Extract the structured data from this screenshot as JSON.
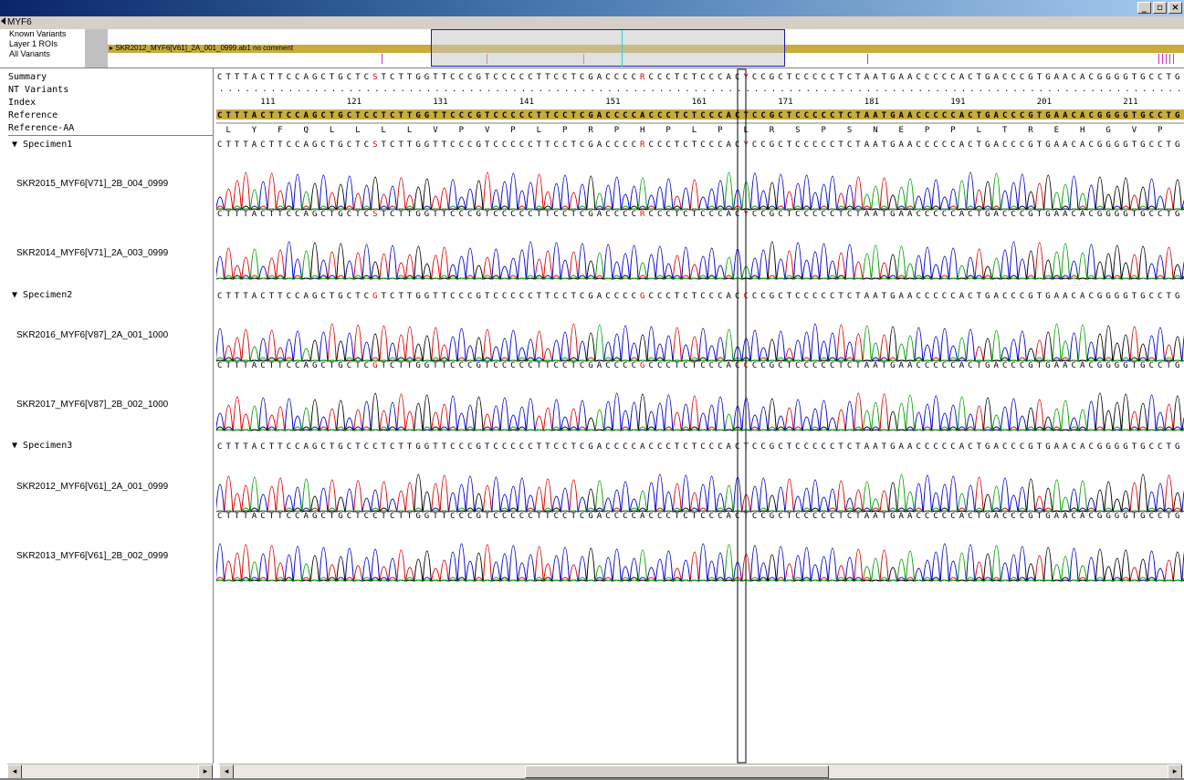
{
  "window": {
    "controls": {
      "minimize": "_",
      "restore": "▫",
      "close": "×"
    }
  },
  "gene_bar": {
    "title": "MYF6"
  },
  "overview": {
    "labels": [
      "Known Variants",
      "Layer 1 ROIs",
      "All Variants"
    ],
    "track_label": "SKR2012_MYF6[V61]_2A_001_0999.ab1 no comment"
  },
  "left_panel": {
    "rows": {
      "summary": "Summary",
      "nt_variants": "NT Variants",
      "index": "Index",
      "reference": "Reference",
      "reference_aa": "Reference-AA"
    },
    "specimens": [
      {
        "name": "Specimen1",
        "reads": [
          "SKR2015_MYF6[V71]_2B_004_0999",
          "SKR2014_MYF6[V71]_2A_003_0999"
        ]
      },
      {
        "name": "Specimen2",
        "reads": [
          "SKR2016_MYF6[V87]_2A_001_1000",
          "SKR2017_MYF6[V87]_2B_002_1000"
        ]
      },
      {
        "name": "Specimen3",
        "reads": [
          "SKR2012_MYF6[V61]_2A_001_0999",
          "SKR2013_MYF6[V61]_2B_002_0999"
        ]
      }
    ]
  },
  "sequence": {
    "summary": "CTTTACTTCCAGCTGCTCSTCTTGGTTCCCGTCCCCCTTCCTCGACCCCRCCCTCTCCCACYCCGCTCCCCCTCTAATGAACCCCCACTGACCCGTGAACACGGGGTGCCTGC",
    "reference": "CTTTACTTCCAGCTGCTCCTCTTGGTTCCCGTCCCCCTTCCTCGACCCCACCCTCTCCCACTCCGCTCCCCCTCTAATGAACCCCCACTGACCCGTGAACACGGGGTGCCTGC",
    "index_labels": [
      "111",
      "121",
      "131",
      "141",
      "151",
      "161",
      "171",
      "181",
      "191",
      "201",
      "211"
    ],
    "amino_acids": [
      "L",
      "Y",
      "F",
      "Q",
      "L",
      "L",
      "L",
      "L",
      "V",
      "P",
      "V",
      "P",
      "L",
      "P",
      "R",
      "P",
      "H",
      "P",
      "L",
      "P",
      "L",
      "R",
      "S",
      "P",
      "S",
      "N",
      "E",
      "P",
      "P",
      "L",
      "T",
      "R",
      "E",
      "H",
      "G",
      "V",
      "P"
    ],
    "reads": [
      {
        "seq": "CTTTACTTCCAGCTGCTCSTCTTGGTTCCCGTCCCCCTTCCTCGACCCCRCCCTCTCCCACYCCGCTCCCCCTCTAATGAACCCCCACTGACCCGTGAACACGGGGTGCCTGC"
      },
      {
        "seq": "CTTTACTTCCAGCTGCTCSTCTTGGTTCCCGTCCCCCTTCCTCGACCCCRCCCTCTCCCACYCCGCTCCCCCTCTAATGAACCCCCACTGACCCGTGAACACGGGGTGCCTGC"
      },
      {
        "seq": "CTTTACTTCCAGCTGCTCGTCTTGGTTCCCGTCCCCCTTCCTCGACCCCGCCCTCTCCCACCCCGCTCCCCCTCTAATGAACCCCCACTGACCCGTGAACACGGGGTGCCTGC"
      },
      {
        "seq": "CTTTACTTCCAGCTGCTCGTCTTGGTTCCCGTCCCCCTTCCTCGACCCCGCCCTCTCCCACCCCGCTCCCCCTCTAATGAACCCCCACTGACCCGTGAACACGGGGTGCCTGC"
      },
      {
        "seq": "CTTTACTTCCAGCTGCTCCTCTTGGTTCCCGTCCCCCTTCCTCGACCCCACCCTCTCCCACTCCGCTCCCCCTCTAATGAACCCCCACTGACCCGTGAACACGGGGTGCCTGC"
      },
      {
        "seq": "CTTTACTTCCAGCTGCTCCTCTTGGTTCCCGTCCCCCTTCCTCGACCCCACCCTCTCCCACTCCGCTCCCCCTCTAATGAACCCCCACTGACCCGTGAACACGGGGTGCCTGC"
      }
    ],
    "base_colors": {
      "A": "#00a000",
      "C": "#0000d0",
      "G": "#000000",
      "T": "#e00000",
      "ambiguous": "#e00000"
    },
    "reference_highlight": "#c8ac3c"
  },
  "scrollbars": {
    "left": "◂",
    "right": "▸"
  }
}
